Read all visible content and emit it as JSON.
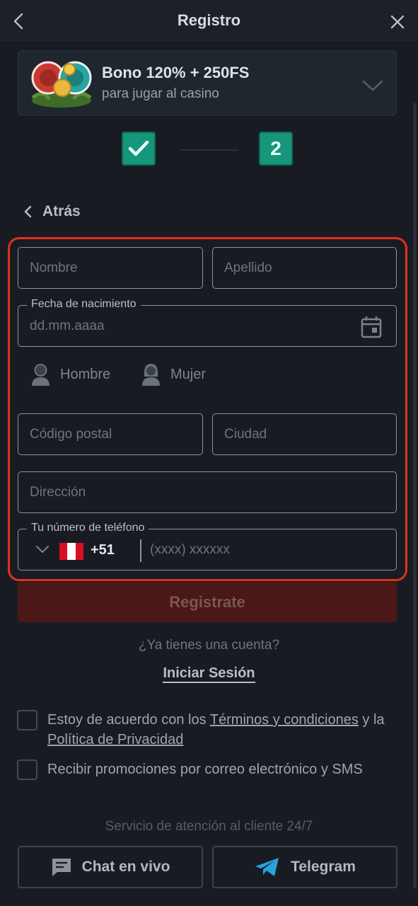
{
  "header": {
    "title": "Registro"
  },
  "bonus": {
    "title": "Bono 120% + 250FS",
    "subtitle": "para jugar al casino"
  },
  "steps": {
    "step2": "2"
  },
  "back": {
    "label": "Atrás"
  },
  "form": {
    "first_name_placeholder": "Nombre",
    "last_name_placeholder": "Apellido",
    "birth_legend": "Fecha de nacimiento",
    "birth_placeholder": "dd.mm.aaaa",
    "gender_male": "Hombre",
    "gender_female": "Mujer",
    "postal_placeholder": "Código postal",
    "city_placeholder": "Ciudad",
    "address_placeholder": "Dirección",
    "phone_legend": "Tu número de teléfono",
    "phone_code": "+51",
    "phone_placeholder": "(xxxx) xxxxxx"
  },
  "register_button": "Registrate",
  "account": {
    "question": "¿Ya tienes una cuenta?",
    "login": "Iniciar Sesión"
  },
  "consent": {
    "t1": "Estoy de acuerdo con los ",
    "terms": "Términos y condiciones",
    "t2": " y la ",
    "privacy": "Política de Privacidad",
    "promo": "Recibir promociones por correo electrónico y SMS"
  },
  "support": {
    "title": "Servicio de atención al cliente 24/7",
    "chat": "Chat en vivo",
    "telegram": "Telegram"
  },
  "colors": {
    "accent": "#16967a",
    "highlight": "#e0301e",
    "register_bg": "#4a1816"
  }
}
